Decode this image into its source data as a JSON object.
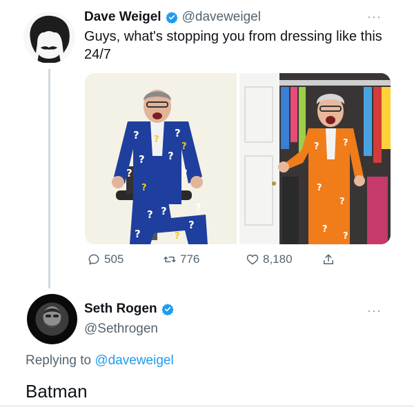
{
  "tweet": {
    "author_name": "Dave Weigel",
    "author_handle": "@daveweigel",
    "more_label": "···",
    "text": "Guys, what's stopping you from dressing like this 24/7",
    "stats": {
      "replies": "505",
      "retweets": "776",
      "likes": "8,180"
    }
  },
  "reply": {
    "author_name": "Seth Rogen",
    "author_handle": "@Sethrogen",
    "more_label": "···",
    "replying_prefix": "Replying to",
    "replying_handle": "@daveweigel",
    "text": "Batman"
  },
  "colors": {
    "verified": "#1d9bf0",
    "link": "#1d9bf0",
    "secondary_text": "#536471",
    "suit_blue": "#1f3f9e",
    "suit_orange": "#f07c1a"
  },
  "icons": [
    "verified-badge-icon",
    "reply-icon",
    "retweet-icon",
    "like-icon",
    "share-icon",
    "more-icon"
  ]
}
